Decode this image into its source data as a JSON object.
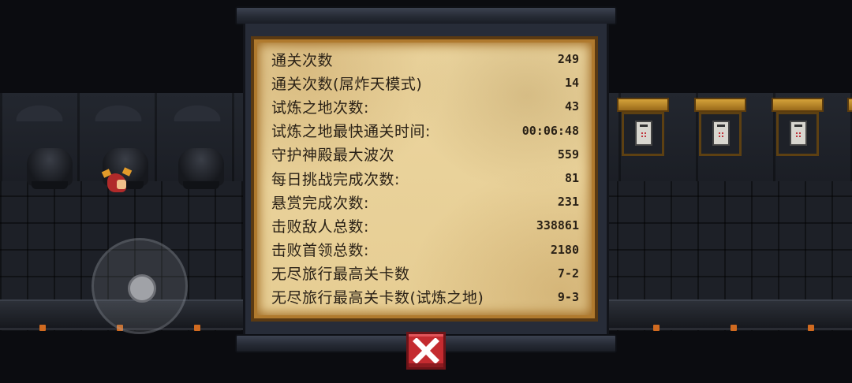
{
  "stats_panel": {
    "rows": [
      {
        "label": "通关次数",
        "value": "249"
      },
      {
        "label": "通关次数(屌炸天模式)",
        "value": "14"
      },
      {
        "label": "试炼之地次数:",
        "value": "43"
      },
      {
        "label": "试炼之地最快通关时间:",
        "value": "00:06:48"
      },
      {
        "label": "守护神殿最大波次",
        "value": "559"
      },
      {
        "label": "每日挑战完成次数:",
        "value": "81"
      },
      {
        "label": "悬赏完成次数:",
        "value": "231"
      },
      {
        "label": "击败敌人总数:",
        "value": "338861"
      },
      {
        "label": "击败首领总数:",
        "value": "2180"
      },
      {
        "label": "无尽旅行最高关卡数",
        "value": "7-2"
      },
      {
        "label": "无尽旅行最高关卡数(试炼之地)",
        "value": "9-3"
      }
    ]
  },
  "controls": {
    "close_icon": "close-x-icon",
    "joystick_icon": "virtual-joystick"
  },
  "colors": {
    "parchment": "#e9d39b",
    "ink": "#2a2116",
    "close_button": "#c42b30",
    "panel_frame": "#272c38"
  }
}
